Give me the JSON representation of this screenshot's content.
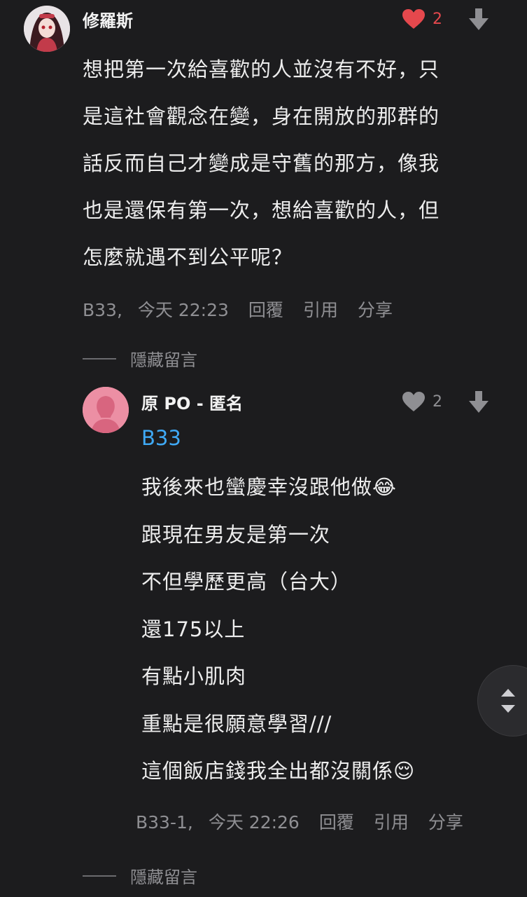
{
  "comment": {
    "author": "修羅斯",
    "like_count": "2",
    "lines": [
      "想把第一次給喜歡的人並沒有不好，只",
      "是這社會觀念在變，身在開放的那群的",
      "話反而自己才變成是守舊的那方，像我",
      "也是還保有第一次，想給喜歡的人，但",
      "怎麼就遇不到公平呢？"
    ],
    "floor": "B33,",
    "time": "今天 22:23",
    "reply_label": "回覆",
    "quote_label": "引用",
    "share_label": "分享",
    "hide_label": "隱藏留言"
  },
  "reply": {
    "author": "原 PO - 匿名",
    "like_count": "2",
    "mention": "B33",
    "lines": [
      "我後來也蠻慶幸沒跟他做😂",
      "跟現在男友是第一次",
      "不但學歷更高（台大）",
      "還175以上",
      "有點小肌肉",
      "重點是很願意學習///",
      "這個飯店錢我全出都沒關係😌"
    ],
    "floor": "B33-1,",
    "time": "今天 22:26",
    "reply_label": "回覆",
    "quote_label": "引用",
    "share_label": "分享",
    "hide_label": "隱藏留言"
  },
  "colors": {
    "background": "#1c1c1e",
    "like_active": "#e5484d",
    "mention": "#3fa9f5",
    "avatar_pink": "#ec8fa4"
  },
  "icons": {
    "like": "heart-icon",
    "dislike": "down-arrow-icon",
    "scroll": "up-down-chevron-icon"
  }
}
